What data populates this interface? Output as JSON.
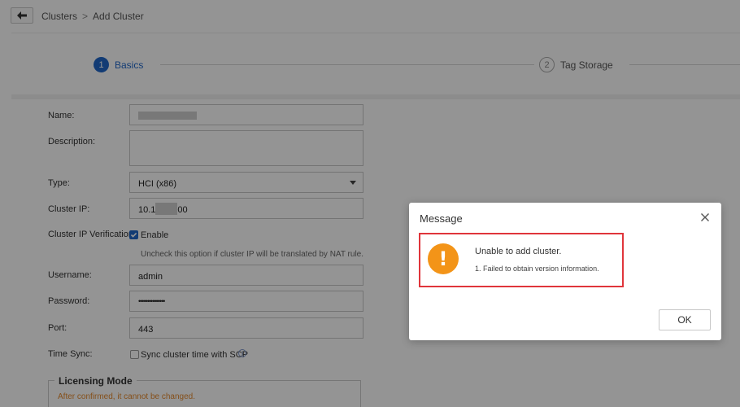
{
  "breadcrumb": {
    "root": "Clusters",
    "separator": ">",
    "current": "Add Cluster"
  },
  "stepper": {
    "steps": [
      {
        "number": "1",
        "label": "Basics",
        "active": true
      },
      {
        "number": "2",
        "label": "Tag Storage",
        "active": false
      }
    ]
  },
  "form": {
    "name": {
      "label": "Name:",
      "value": ""
    },
    "description": {
      "label": "Description:",
      "value": ""
    },
    "type": {
      "label": "Type:",
      "value": "HCI (x86)"
    },
    "cluster_ip": {
      "label": "Cluster IP:",
      "value_prefix": "10.1",
      "value_suffix": "00"
    },
    "ip_verification": {
      "label": "Cluster IP Verification:",
      "checkbox_label": "Enable",
      "checked": true,
      "hint": "Uncheck this option if cluster IP will be translated by NAT rule."
    },
    "username": {
      "label": "Username:",
      "value": "admin"
    },
    "password": {
      "label": "Password:",
      "value": "•••••••••••••••"
    },
    "port": {
      "label": "Port:",
      "value": "443"
    },
    "time_sync": {
      "label": "Time Sync:",
      "checkbox_label": "Sync cluster time with SCP",
      "checked": false,
      "info_icon": "i"
    }
  },
  "licensing": {
    "title": "Licensing Mode",
    "note": "After confirmed, it cannot be changed."
  },
  "dialog": {
    "title": "Message",
    "icon_glyph": "!",
    "message": "Unable to add cluster.",
    "detail": "1. Failed to obtain version information.",
    "ok_label": "OK"
  },
  "colors": {
    "accent": "#1f67c9",
    "warning": "#f39418",
    "highlight_border": "#e0353b",
    "note": "#e58a2f"
  }
}
